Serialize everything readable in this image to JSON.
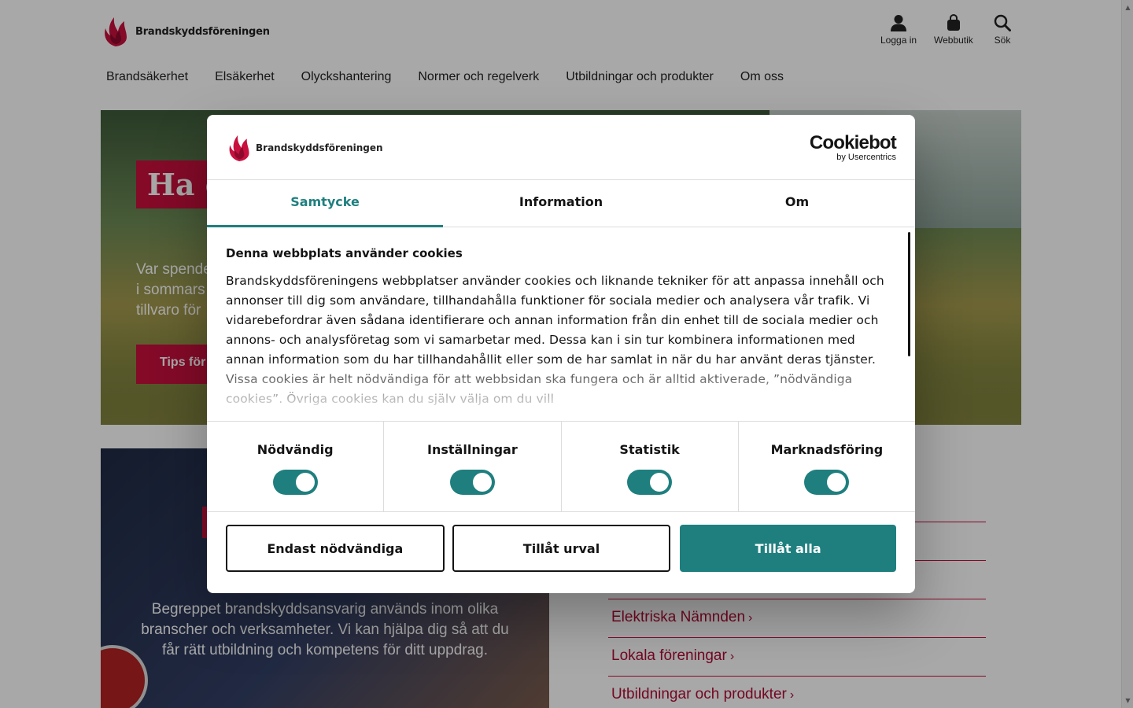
{
  "site": {
    "logo_text": "Brandskyddsföreningen",
    "utility": [
      {
        "label": "Logga in",
        "icon": "user-icon"
      },
      {
        "label": "Webbutik",
        "icon": "shopping-bag-icon"
      },
      {
        "label": "Sök",
        "icon": "search-icon"
      }
    ],
    "nav": [
      "Brandsäkerhet",
      "Elsäkerhet",
      "Olyckshantering",
      "Normer och regelverk",
      "Utbildningar och produkter",
      "Om oss"
    ],
    "hero": {
      "title": "Ha e",
      "text_lines": [
        "Var spende",
        "i sommars",
        "tillvaro för"
      ],
      "button": "Tips för"
    },
    "card": {
      "text": "Begreppet brandskyddsansvarig används inom olika branscher och verksamheter. Vi kan hjälpa dig så att du får rätt utbildning och kompetens för ditt uppdrag."
    },
    "links": [
      "",
      "",
      "Elektriska Nämnden",
      "Lokala föreningar",
      "Utbildningar och produkter"
    ]
  },
  "modal": {
    "logo_text": "Brandskyddsföreningen",
    "brand": {
      "name": "Cookiebot",
      "by": "by Usercentrics"
    },
    "tabs": [
      {
        "label": "Samtycke",
        "active": true
      },
      {
        "label": "Information",
        "active": false
      },
      {
        "label": "Om",
        "active": false
      }
    ],
    "heading": "Denna webbplats använder cookies",
    "body": "Brandskyddsföreningens webbplatser använder cookies och liknande tekniker för att anpassa innehåll och annonser till dig som användare, tillhandahålla funktioner för sociala medier och analysera vår trafik. Vi vidarebefordrar även sådana identifierare och annan information från din enhet till de sociala medier och annons- och analysföretag som vi samarbetar med. Dessa kan i sin tur kombinera informationen med annan information som du har tillhandahållit eller som de har samlat in när du har använt deras tjänster. Vissa cookies är helt nödvändiga för att webbsidan ska fungera och är alltid aktiverade, ”nödvändiga cookies”. Övriga cookies kan du själv välja om du vill",
    "toggles": [
      {
        "label": "Nödvändig",
        "on": true
      },
      {
        "label": "Inställningar",
        "on": true
      },
      {
        "label": "Statistik",
        "on": true
      },
      {
        "label": "Marknadsföring",
        "on": true
      }
    ],
    "buttons": {
      "deny": "Endast nödvändiga",
      "selection": "Tillåt urval",
      "allow_all": "Tillåt alla"
    }
  },
  "colors": {
    "brand_red": "#c8103e",
    "cookiebot_teal": "#1f7f7f"
  }
}
